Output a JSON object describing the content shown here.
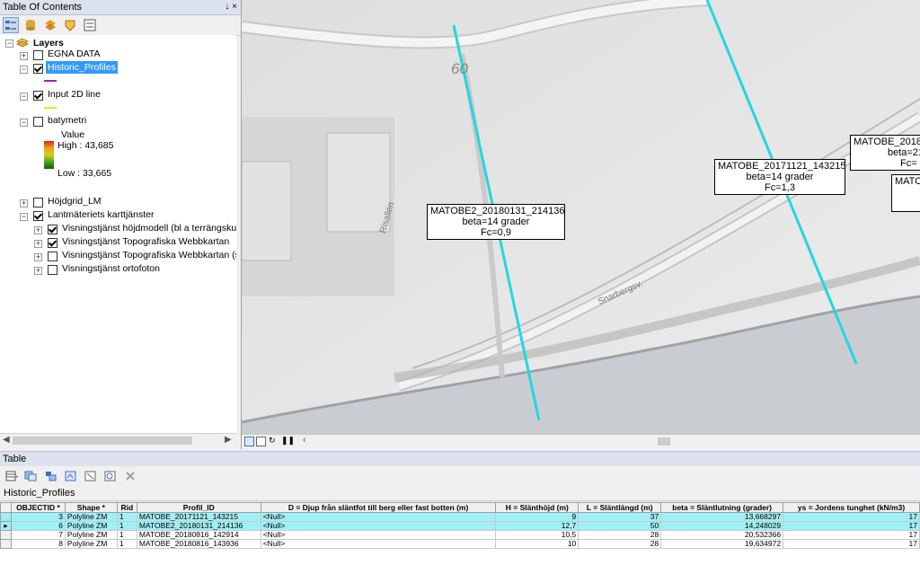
{
  "toc": {
    "title": "Table Of Contents",
    "title_icons": "↓ ×",
    "root_label": "Layers",
    "layers": [
      {
        "label": "EGNA DATA",
        "checked": false
      },
      {
        "label": "Historic_Profiles",
        "checked": true,
        "symbol_color": "#a020c0"
      },
      {
        "label": "Input 2D line",
        "checked": true,
        "symbol_color": "#e8e800"
      },
      {
        "label": "batymetri",
        "checked": false
      },
      {
        "label": "Höjdgrid_LM",
        "checked": false
      },
      {
        "label": "Lantmäteriets karttjänster",
        "checked": true
      }
    ],
    "batymetri_legend": {
      "value_label": "Value",
      "high": "High : 43,685",
      "low": "Low : 33,665"
    },
    "sublayers": [
      {
        "label": "Visningstjänst höjdmodell (bl a terrängskugg",
        "checked": true
      },
      {
        "label": "Visningstjänst Topografiska Webbkartan",
        "checked": true
      },
      {
        "label": "Visningstjänst Topografiska Webbkartan (ski",
        "checked": false
      },
      {
        "label": "Visningstjänst ortofoton",
        "checked": false
      }
    ]
  },
  "map": {
    "number_label": "60",
    "road_label_1": "Risallén",
    "road_label_2": "Snarbergsv.",
    "profile_color": "#22d8e0",
    "labels": [
      {
        "lines": [
          "MATOBE2_20180131_214136",
          "beta=14 grader",
          "Fc=0,9"
        ]
      },
      {
        "lines": [
          "MATOBE_20171121_143215",
          "beta=14 grader",
          "Fc=1,3"
        ]
      },
      {
        "lines": [
          "MATOBE_2018",
          "beta=21",
          "Fc="
        ]
      },
      {
        "lines": [
          "MATOBE_"
        ]
      }
    ]
  },
  "table": {
    "title": "Table",
    "tab_label": "Historic_Profiles",
    "columns": [
      "OBJECTID *",
      "Shape *",
      "Rid",
      "Profil_ID",
      "D = Djup från släntfot till berg eller fast botten (m)",
      "H = Slänthöjd (m)",
      "L = Släntlängd (m)",
      "beta = Släntlutning (grader)",
      "ys = Jordens tunghet (kN/m3)"
    ],
    "rows": [
      {
        "selected": true,
        "current": false,
        "cells": [
          "3",
          "Polyline ZM",
          "1",
          "MATOBE_20171121_143215",
          "<Null>",
          "9",
          "37",
          "13,668297",
          "17"
        ]
      },
      {
        "selected": true,
        "current": true,
        "cells": [
          "6",
          "Polyline ZM",
          "1",
          "MATOBE2_20180131_214136",
          "<Null>",
          "12,7",
          "50",
          "14,248029",
          "17"
        ]
      },
      {
        "selected": false,
        "current": false,
        "cells": [
          "7",
          "Polyline ZM",
          "1",
          "MATOBE_20180816_142914",
          "<Null>",
          "10,5",
          "28",
          "20,532366",
          "17"
        ]
      },
      {
        "selected": false,
        "current": false,
        "cells": [
          "8",
          "Polyline ZM",
          "1",
          "MATOBE_20180816_143936",
          "<Null>",
          "10",
          "28",
          "19,634972",
          "17"
        ]
      }
    ]
  }
}
